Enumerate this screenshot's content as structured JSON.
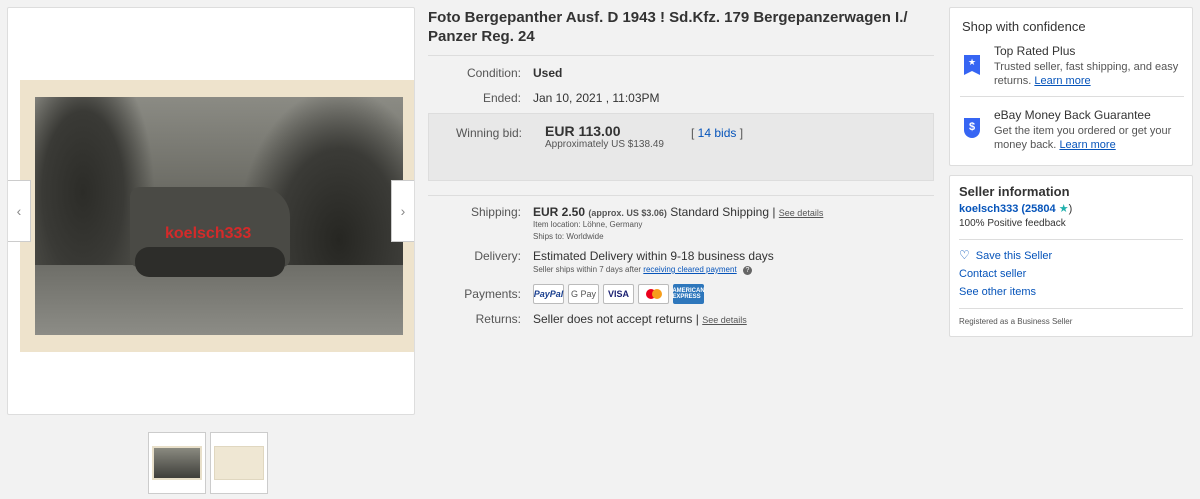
{
  "listing": {
    "title": "Foto Bergepanther Ausf. D 1943 ! Sd.Kfz. 179 Bergepanzerwagen I./ Panzer Reg. 24",
    "watermark": "koelsch333",
    "condition_label": "Condition:",
    "condition_value": "Used",
    "ended_label": "Ended:",
    "ended_value": "Jan 10, 2021 , 11:03PM",
    "bid_label": "Winning bid:",
    "bid_amount": "EUR 113.00",
    "bid_approx": "Approximately US $138.49",
    "bid_count_open": "[ ",
    "bid_count": "14 bids",
    "bid_count_close": " ]",
    "shipping_label": "Shipping:",
    "shipping_amount": "EUR 2.50",
    "shipping_approx": "(approx. US $3.06)",
    "shipping_method": "Standard Shipping |",
    "shipping_details": "See details",
    "item_location": "Item location:  Löhne, Germany",
    "ships_to": "Ships to:  Worldwide",
    "delivery_label": "Delivery:",
    "delivery_value": "Estimated Delivery within 9-18 business days",
    "delivery_note": "Seller ships within 7 days after",
    "delivery_link": "receiving cleared payment",
    "payments_label": "Payments:",
    "payments": {
      "paypal": "PayPal",
      "gpay": "G Pay",
      "visa": "VISA",
      "amex": "AMERICAN EXPRESS"
    },
    "returns_label": "Returns:",
    "returns_value": "Seller does not accept returns |",
    "returns_details": "See details"
  },
  "confidence": {
    "title": "Shop with confidence",
    "items": [
      {
        "icon": "ribbon-icon",
        "heading": "Top Rated Plus",
        "desc": "Trusted seller, fast shipping, and easy returns.",
        "link": "Learn more"
      },
      {
        "icon": "shield-icon",
        "heading": "eBay Money Back Guarantee",
        "desc": "Get the item you ordered or get your money back.",
        "link": "Learn more"
      }
    ]
  },
  "seller": {
    "heading": "Seller information",
    "name": "koelsch333",
    "score": "(25804",
    "score_close": ")",
    "feedback": "100% Positive feedback",
    "save": "Save this Seller",
    "contact": "Contact seller",
    "other": "See other items",
    "registered": "Registered as a Business Seller"
  },
  "colors": {
    "link": "#0654ba",
    "accent": "#3665f3",
    "star": "#21b1ad"
  }
}
